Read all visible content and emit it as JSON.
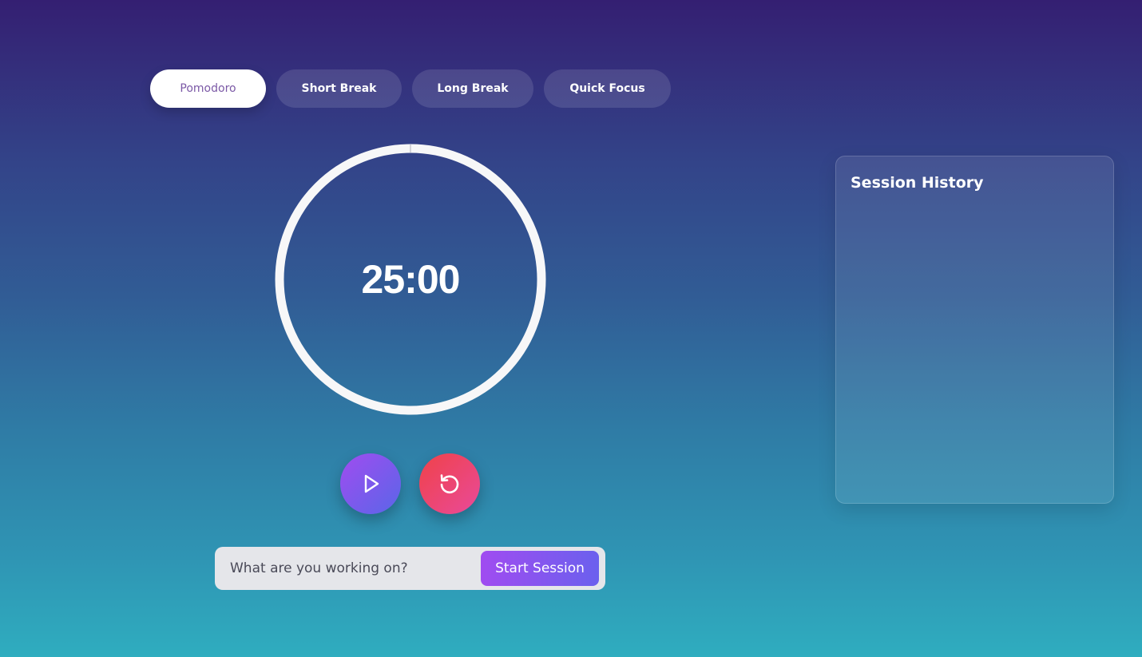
{
  "mode_tabs": [
    {
      "label": "Pomodoro",
      "active": true
    },
    {
      "label": "Short Break",
      "active": false
    },
    {
      "label": "Long Break",
      "active": false
    },
    {
      "label": "Quick Focus",
      "active": false
    }
  ],
  "timer": {
    "display": "25:00",
    "progress": 0
  },
  "controls": {
    "play_icon": "play-icon",
    "reset_icon": "reset-icon"
  },
  "task": {
    "placeholder": "What are you working on?",
    "value": "",
    "start_label": "Start Session"
  },
  "history": {
    "title": "Session History",
    "items": []
  },
  "colors": {
    "active_tab_text": "#7b59a6",
    "play_gradient_start": "#a04cf0",
    "play_gradient_end": "#5a66e8",
    "reset_gradient_start": "#f04248",
    "reset_gradient_end": "#e94a9a"
  }
}
